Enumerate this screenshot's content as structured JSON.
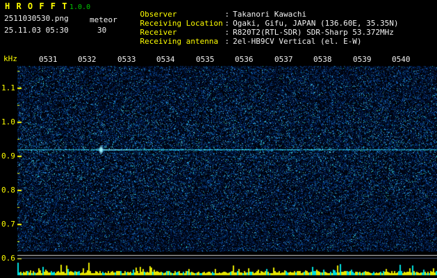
{
  "header": {
    "app_name": "H R O F F T",
    "version": "1.0.0",
    "filename": "2511030530.png",
    "mode": "meteor",
    "datetime": "25.11.03 05:30",
    "duration": "30",
    "colon": ":",
    "info": [
      {
        "label": "Observer",
        "value": "Takanori Kawachi"
      },
      {
        "label": "Receiving Location",
        "value": "Ogaki, Gifu, JAPAN (136.60E, 35.35N)"
      },
      {
        "label": "Receiver",
        "value": "R820T2(RTL-SDR) SDR-Sharp 53.372MHz"
      },
      {
        "label": "Receiving antenna",
        "value": "2el-HB9CV Vertical (el. E-W)"
      }
    ]
  },
  "chart_data": {
    "type": "heatmap",
    "x_ticks": [
      "0531",
      "0532",
      "0533",
      "0534",
      "0535",
      "0536",
      "0537",
      "0538",
      "0539",
      "0540"
    ],
    "y_label": "kHz",
    "y_ticks": [
      "1.1",
      "1.0",
      "0.9",
      "0.8",
      "0.7",
      "0.6"
    ],
    "y_range_khz": [
      0.6,
      1.165
    ],
    "carrier_line_khz": 0.92,
    "secondary_trace_khz": 0.9,
    "meteor_echoes": [
      {
        "time": "0532.3",
        "freq_khz": 0.92,
        "intensity": "strong"
      }
    ],
    "noise_floor_color": "#001840",
    "level_strip": {
      "bar_colors": [
        "#e8e800",
        "#00e0e0"
      ],
      "description": "signal level bars along time axis"
    }
  },
  "colors": {
    "accent_yellow": "#ffff00",
    "text_white": "#f2f2f2",
    "version_green": "#00c800",
    "signal_cyan": "#00ffff",
    "background": "#000000"
  }
}
